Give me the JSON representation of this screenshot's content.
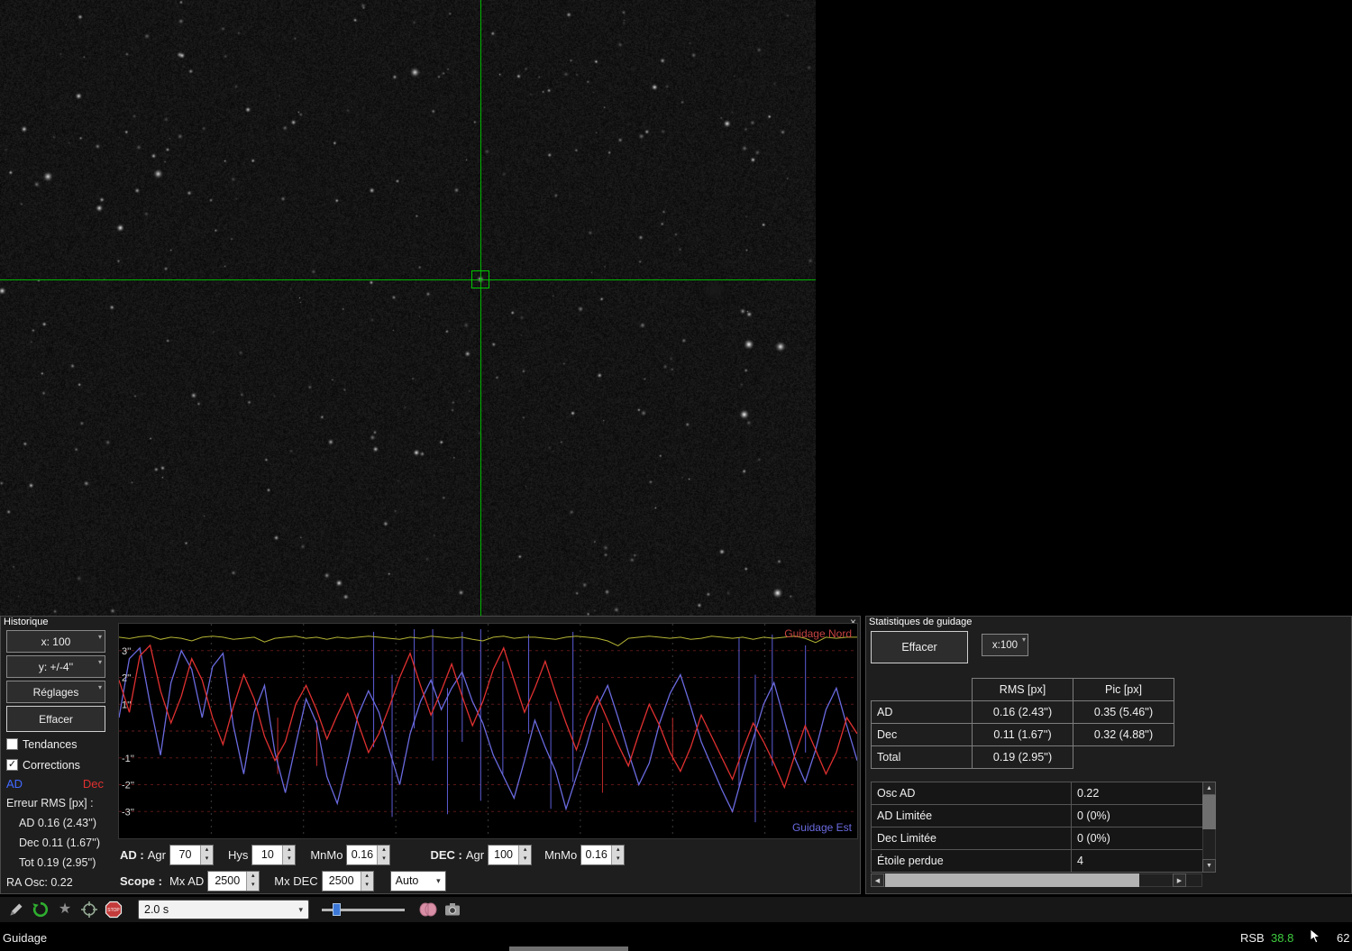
{
  "icons": {
    "close": "×",
    "check": "✓",
    "chevron_down": "▾",
    "spin_up": "▴",
    "spin_down": "▾",
    "star": "★",
    "arrow_up": "▲",
    "arrow_down": "▼",
    "arrow_left": "◀",
    "arrow_right": "▶"
  },
  "colors": {
    "ra_blue": "#4169ff",
    "dec_red": "#e03030",
    "snr_yellow": "#b5b535",
    "crosshair_green": "#00b400",
    "rsb_green": "#3fcc3f"
  },
  "history": {
    "title": "Historique",
    "sidebar": {
      "scale_x": "x: 100",
      "scale_y": "y: +/-4''",
      "reglages": "Réglages",
      "effacer": "Effacer",
      "tendances": "Tendances",
      "corrections": "Corrections",
      "tendances_checked": "",
      "corrections_checked": "✓",
      "ad": "AD",
      "dec": "Dec",
      "rms_title": "Erreur RMS [px] :",
      "rms_ra": "AD 0.16 (2.43'')",
      "rms_dec": "Dec 0.11 (1.67'')",
      "rms_tot": "Tot 0.19 (2.95'')",
      "ra_osc": "RA Osc: 0.22"
    },
    "graph": {
      "range": 4,
      "north_label": "Guidage Nord",
      "east_label": "Guidage Est",
      "y_ticks": [
        {
          "v": 3,
          "label": "3''"
        },
        {
          "v": 2,
          "label": "2''"
        },
        {
          "v": 1,
          "label": "1''"
        },
        {
          "v": -1,
          "label": "-1''"
        },
        {
          "v": -2,
          "label": "-2''"
        },
        {
          "v": -3,
          "label": "-3''"
        }
      ],
      "ra": [
        0.5,
        2.7,
        3.1,
        1.0,
        -0.9,
        1.8,
        3.0,
        2.3,
        0.5,
        2.4,
        2.9,
        0.2,
        -1.6,
        0.7,
        1.7,
        -0.8,
        -2.3,
        -0.5,
        1.2,
        0.3,
        -1.7,
        -2.7,
        -1.1,
        0.6,
        1.5,
        0.7,
        -0.7,
        -2.0,
        -0.1,
        1.1,
        1.9,
        0.8,
        1.6,
        2.2,
        1.1,
        0.3,
        -0.9,
        -1.7,
        -2.5,
        -1.1,
        0.4,
        -0.6,
        -1.5,
        -2.9,
        -1.7,
        -0.5,
        0.9,
        1.7,
        0.5,
        -0.8,
        -2.0,
        -1.2,
        0.3,
        1.4,
        2.1,
        0.9,
        -0.4,
        -1.3,
        -2.2,
        -3.0,
        -1.6,
        -0.3,
        1.0,
        1.8,
        0.4,
        -1.0,
        -1.9,
        -0.7,
        0.8,
        1.6,
        0.2,
        -1.1
      ],
      "dec": [
        1.9,
        0.7,
        2.8,
        3.2,
        1.5,
        0.3,
        1.3,
        2.7,
        1.9,
        0.5,
        -0.5,
        0.9,
        2.1,
        1.2,
        -0.2,
        -1.1,
        -0.4,
        1.0,
        1.7,
        0.8,
        -0.3,
        0.6,
        1.4,
        0.3,
        -0.8,
        -0.1,
        0.9,
        2.0,
        2.9,
        1.7,
        0.6,
        1.5,
        2.5,
        1.3,
        0.2,
        1.1,
        2.3,
        3.1,
        1.9,
        0.7,
        1.6,
        2.6,
        1.4,
        0.3,
        -0.7,
        0.5,
        1.3,
        0.4,
        -0.5,
        -1.3,
        -0.1,
        1.0,
        0.2,
        -0.8,
        -1.5,
        -0.6,
        0.6,
        -0.2,
        -1.0,
        -1.8,
        -0.7,
        0.3,
        -0.4,
        -1.2,
        -2.1,
        -0.9,
        0.2,
        -0.7,
        -1.6,
        -0.8,
        0.5,
        -0.1
      ],
      "snr": [
        3.5,
        3.45,
        3.52,
        3.55,
        3.42,
        3.5,
        3.46,
        3.36,
        3.5,
        3.54,
        3.5,
        3.42,
        3.46,
        3.5,
        3.32,
        3.46,
        3.5,
        3.54,
        3.46,
        3.5,
        3.42,
        3.5,
        3.46,
        3.5,
        3.54,
        3.5,
        3.46,
        3.42,
        3.5,
        3.46,
        3.54,
        3.5,
        3.46,
        3.5,
        3.42,
        3.36,
        3.5,
        3.54,
        3.46,
        3.5,
        3.5,
        3.46,
        3.42,
        3.5,
        3.54,
        3.5,
        3.46,
        3.36,
        3.18,
        3.46,
        3.5,
        3.54,
        3.5,
        3.46,
        3.5,
        3.42,
        3.46,
        3.54,
        3.5,
        3.46,
        3.5,
        3.42,
        3.5,
        3.46,
        3.5,
        3.54,
        3.46,
        3.3,
        3.5,
        3.46,
        3.5,
        3.5
      ],
      "ra_bars": [
        [
          0.345,
          3.7,
          -0.6
        ],
        [
          0.37,
          2.1,
          -3.2
        ],
        [
          0.4,
          3.8,
          0.1
        ],
        [
          0.425,
          3.8,
          -1.1
        ],
        [
          0.445,
          1.6,
          -3.1
        ],
        [
          0.465,
          3.7,
          -0.4
        ],
        [
          0.49,
          3.8,
          -2.6
        ],
        [
          0.52,
          2.6,
          -1.6
        ],
        [
          0.555,
          3.6,
          -0.1
        ],
        [
          0.585,
          1.1,
          -2.9
        ],
        [
          0.615,
          3.7,
          -1.9
        ],
        [
          0.84,
          3.5,
          -2.1
        ],
        [
          0.862,
          2.1,
          -3.4
        ],
        [
          0.885,
          3.6,
          -1.3
        ],
        [
          0.93,
          3.2,
          -0.8
        ]
      ],
      "dec_bars": [
        [
          0.215,
          0.5,
          -1.6
        ],
        [
          0.268,
          0.4,
          -1.3
        ],
        [
          0.655,
          0.3,
          -2.3
        ],
        [
          0.75,
          0.5,
          -1.1
        ]
      ]
    },
    "controls": {
      "ra_label": "AD :",
      "agr_label": "Agr",
      "agr_ra": "70",
      "hys_label": "Hys",
      "hys": "10",
      "mnmo_label": "MnMo",
      "mnmo_ra": "0.16",
      "dec_label": "DEC :",
      "agr_dec": "100",
      "mnmo_dec": "0.16",
      "scope_label": "Scope :",
      "mx_ad_label": "Mx AD",
      "mx_ad": "2500",
      "mx_dec_label": "Mx DEC",
      "mx_dec": "2500",
      "dec_mode": "Auto"
    }
  },
  "stats": {
    "title": "Statistiques de guidage",
    "effacer": "Effacer",
    "scale": "x:100",
    "table": {
      "col_rms": "RMS [px]",
      "col_pic": "Pic [px]",
      "rows": [
        {
          "label": "AD",
          "rms": "0.16 (2.43'')",
          "pic": "0.35 (5.46'')"
        },
        {
          "label": "Dec",
          "rms": "0.11 (1.67'')",
          "pic": "0.32 (4.88'')"
        },
        {
          "label": "Total",
          "rms": "0.19 (2.95'')",
          "pic": ""
        }
      ]
    },
    "list": {
      "rows": [
        {
          "label": "Osc AD",
          "value": "0.22"
        },
        {
          "label": "AD Limitée",
          "value": "0 (0%)"
        },
        {
          "label": "Dec Limitée",
          "value": "0 (0%)"
        },
        {
          "label": "Étoile perdue",
          "value": "4"
        }
      ]
    }
  },
  "toolbar": {
    "exposure": "2.0 s",
    "stop_label": "STOP"
  },
  "status": {
    "mode": "Guidage",
    "rsb_label": "RSB",
    "rsb_value": "38.8",
    "frame_count": "62"
  }
}
